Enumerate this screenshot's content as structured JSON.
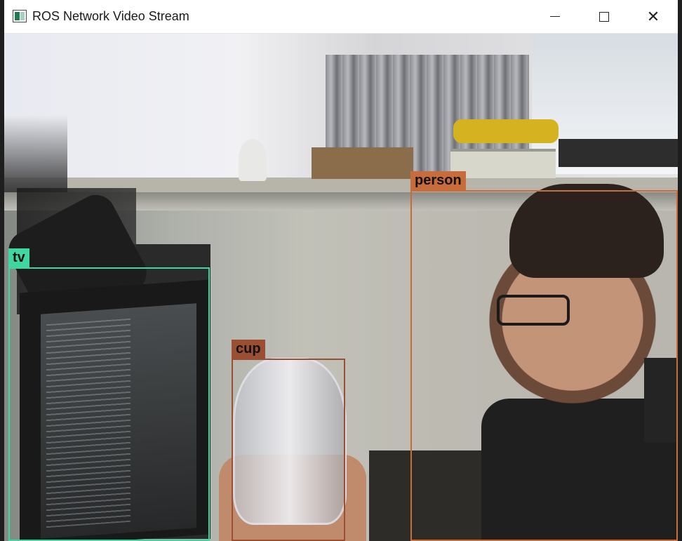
{
  "window": {
    "title": "ROS Network Video Stream",
    "icon": "app-window-icon",
    "controls": {
      "minimize_icon": "minimize-icon",
      "maximize_icon": "maximize-icon",
      "close_icon": "close-icon",
      "close_glyph": "✕"
    }
  },
  "video": {
    "detections": [
      {
        "label": "tv",
        "color": "#40d6a1"
      },
      {
        "label": "cup",
        "color": "#9b4f32"
      },
      {
        "label": "person",
        "color": "#c96c3b"
      }
    ]
  }
}
